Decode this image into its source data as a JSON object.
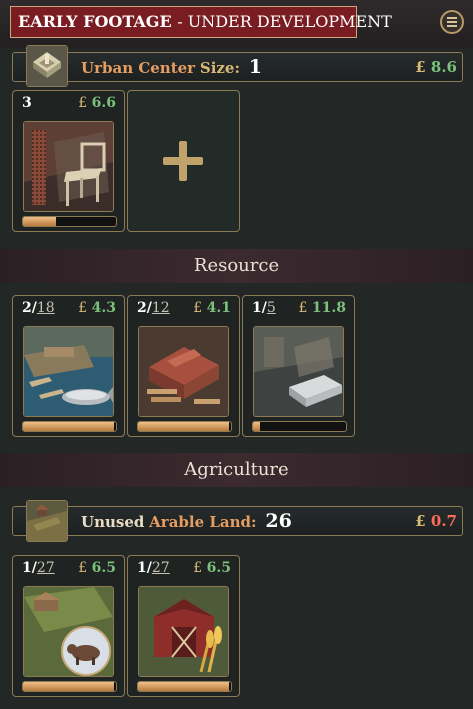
{
  "banner": {
    "title": "EARLY FOOTAGE",
    "subtitle": "- UNDER DEVELOPMENT"
  },
  "urban": {
    "name": "Urban Center",
    "size_label": "Size:",
    "size_value": "1",
    "income": "8.6",
    "card": {
      "count": "3",
      "price": "6.6",
      "progress": 0.35
    }
  },
  "currency_symbol": "£",
  "resource": {
    "header": "Resource",
    "cards": [
      {
        "employed": "2",
        "capacity": "18",
        "price": "4.3",
        "progress": 0.98
      },
      {
        "employed": "2",
        "capacity": "12",
        "price": "4.1",
        "progress": 0.98
      },
      {
        "employed": "1",
        "capacity": "5",
        "price": "11.8",
        "progress": 0.08
      }
    ]
  },
  "agriculture": {
    "header": "Agriculture",
    "unused_label": "Unused",
    "arable_label": "Arable Land:",
    "arable_value": "26",
    "income": "0.7",
    "cards": [
      {
        "employed": "1",
        "capacity": "27",
        "price": "6.5",
        "progress": 0.98
      },
      {
        "employed": "1",
        "capacity": "27",
        "price": "6.5",
        "progress": 0.98
      }
    ]
  },
  "colors": {
    "accent_red": "#7a1d22",
    "gold": "#d8b977",
    "positive": "#7cc17b",
    "negative": "#ff6c5a",
    "orange": "#e59d62"
  }
}
